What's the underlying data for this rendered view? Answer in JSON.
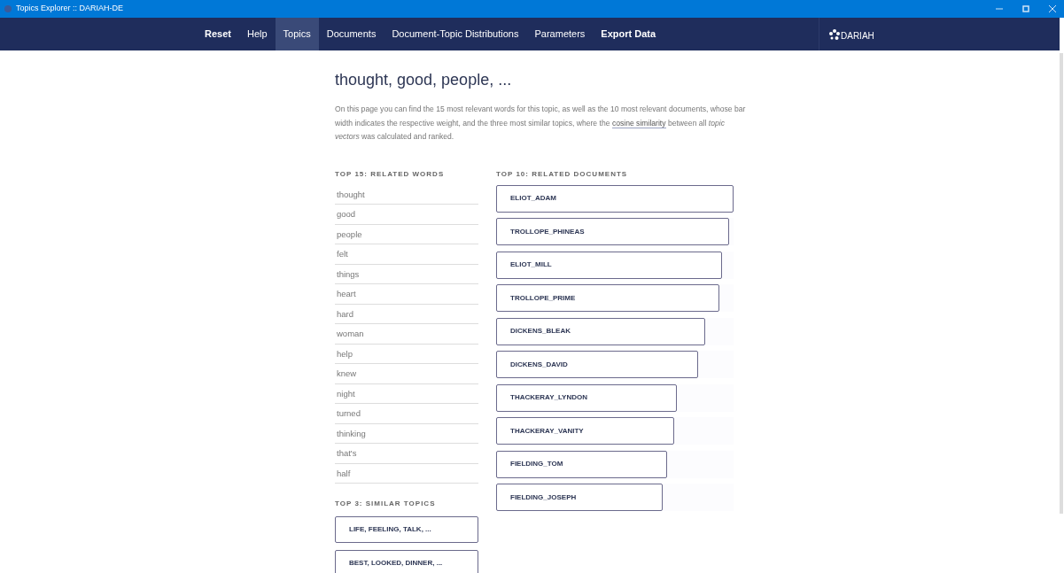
{
  "window": {
    "title": "Topics Explorer :: DARIAH-DE"
  },
  "nav": [
    {
      "label": "Reset",
      "bold": true,
      "selected": false
    },
    {
      "label": "Help",
      "bold": false,
      "selected": false
    },
    {
      "label": "Topics",
      "bold": false,
      "selected": true
    },
    {
      "label": "Documents",
      "bold": false,
      "selected": false
    },
    {
      "label": "Document-Topic Distributions",
      "bold": false,
      "selected": false
    },
    {
      "label": "Parameters",
      "bold": false,
      "selected": false
    },
    {
      "label": "Export Data",
      "bold": true,
      "selected": false
    }
  ],
  "brand": "DARIAH",
  "heading": "thought, good, people, ...",
  "intro": {
    "before": "On this page you can find the 15 most relevant words for this topic, as well as the 10 most relevant documents, whose bar width indicates the respective weight, and the three most similar topics, where the",
    "link": "cosine similarity",
    "after": "between all *topic vectors* was calculated and ranked."
  },
  "related_words": {
    "title": "TOP 15: RELATED WORDS",
    "items": [
      "thought",
      "good",
      "people",
      "felt",
      "things",
      "heart",
      "hard",
      "woman",
      "help",
      "knew",
      "night",
      "turned",
      "thinking",
      "that's",
      "half"
    ]
  },
  "similar_topics": {
    "title": "TOP 3: SIMILAR TOPICS",
    "items": [
      "LIFE, FEELING, TALK, ...",
      "BEST, LOOKED, DINNER, ..."
    ]
  },
  "related_documents": {
    "title": "TOP 10: RELATED DOCUMENTS",
    "items": [
      {
        "label": "ELIOT_ADAM",
        "level": 1
      },
      {
        "label": "TROLLOPE_PHINEAS",
        "level": 0.98
      },
      {
        "label": "ELIOT_MILL",
        "level": 0.95
      },
      {
        "label": "TROLLOPE_PRIME",
        "level": 0.94
      },
      {
        "label": "DICKENS_BLEAK",
        "level": 0.88
      },
      {
        "label": "DICKENS_DAVID",
        "level": 0.85
      },
      {
        "label": "THACKERAY_LYNDON",
        "level": 0.76
      },
      {
        "label": "THACKERAY_VANITY",
        "level": 0.75
      },
      {
        "label": "FIELDING_TOM",
        "level": 0.72
      },
      {
        "label": "FIELDING_JOSEPH",
        "level": 0.7
      }
    ]
  }
}
